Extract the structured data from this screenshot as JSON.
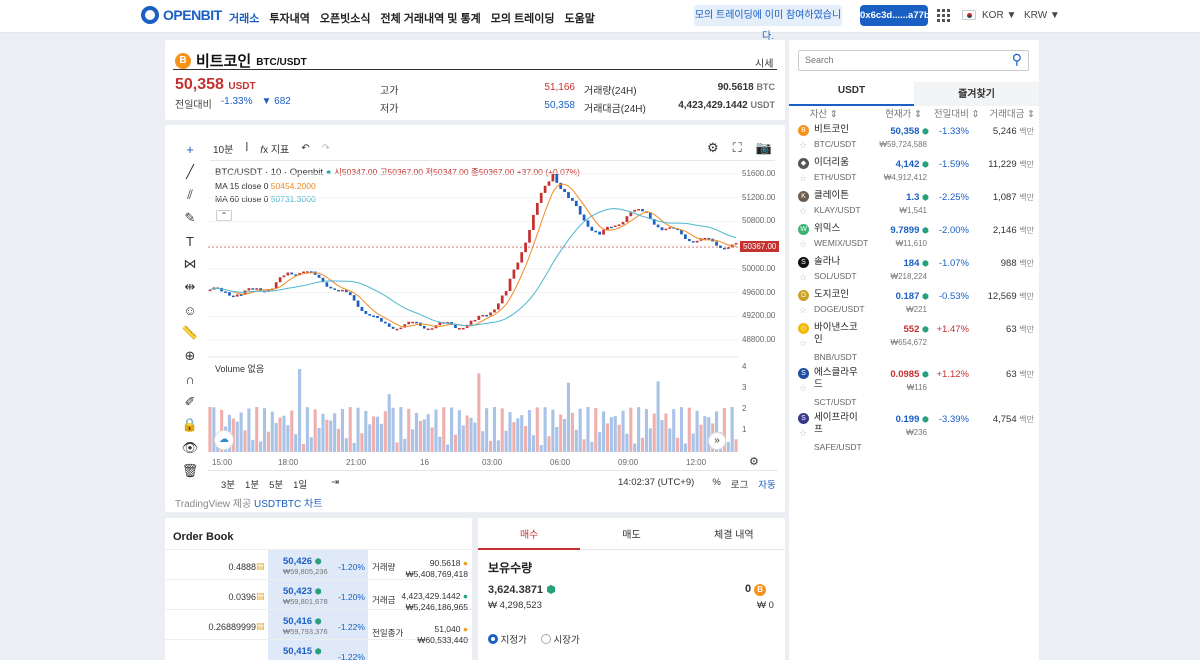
{
  "nav": {
    "logo": "OPENBIT",
    "menu": [
      "거래소",
      "투자내역",
      "오픈빗소식",
      "전체 거래내역 및 통계",
      "모의 트레이딩",
      "도움말"
    ],
    "notice": "모의 트레이딩에 이미 참여하였습니다.",
    "wallet": "0x6c3d......a77b",
    "lang": "KOR ▼",
    "currency": "KRW ▼"
  },
  "header": {
    "icon": "B",
    "name": "비트코인",
    "pair": "BTC/USDT",
    "tab": "시세",
    "price": "50,358",
    "unit": "USDT",
    "change_label": "전일대비",
    "change_pct": "-1.33%",
    "change_abs": "▼ 682",
    "stats": [
      {
        "label": "고가",
        "value": "51,166",
        "label2": "거래량(24H)",
        "value2": "90.5618",
        "unit2": "BTC"
      },
      {
        "label": "저가",
        "value": "50,358",
        "label2": "거래대금(24H)",
        "value2": "4,423,429.1442",
        "unit2": "USDT"
      }
    ]
  },
  "chart": {
    "interval": "10분",
    "indicators": "지표",
    "title": "BTC/USDT · 10 · Openbit",
    "ohlc": "시50347.00 고50367.00 저50347.00 종50367.00 +37.00 (+0.07%)",
    "ma15_label": "MA 15 close 0",
    "ma15": "50454.2000",
    "ma60_label": "MA 60 close 0",
    "ma60": "50731.3000",
    "last_price": "50367.00",
    "volume_label": "Volume",
    "volume_note": "없음",
    "yticks": [
      "51600.00",
      "51200.00",
      "50800.00",
      "50400.00",
      "50000.00",
      "49600.00",
      "49200.00",
      "48800.00"
    ],
    "vticks": [
      "4",
      "3",
      "2",
      "1"
    ],
    "xticks": [
      "15:00",
      "18:00",
      "21:00",
      "16",
      "03:00",
      "06:00",
      "09:00",
      "12:00"
    ],
    "ranges": [
      "3분",
      "1분",
      "5분",
      "1일"
    ],
    "time": "14:02:37 (UTC+9)",
    "pct": "%",
    "log": "로그",
    "auto": "자동",
    "footer_prefix": "TradingView 제공",
    "footer_link": "USDTBTC 차트"
  },
  "orderbook": {
    "title": "Order Book",
    "rows": [
      {
        "qty": "0.4888",
        "price": "50,426",
        "krw": "₩59,805,236",
        "pct": "-1.20%"
      },
      {
        "qty": "0.0396",
        "price": "50,423",
        "krw": "₩59,801,678",
        "pct": "-1.20%"
      },
      {
        "qty": "0.26889999",
        "price": "50,416",
        "krw": "₩59,793,376",
        "pct": "-1.22%"
      },
      {
        "qty": "",
        "price": "50,415",
        "krw": "",
        "pct": "-1.22%"
      }
    ],
    "info": [
      {
        "label": "거래량",
        "v1": "90.5618",
        "v2": "₩5,408,769,418"
      },
      {
        "label": "거래금",
        "v1": "4,423,429.1442",
        "v2": "₩5,246,186,965"
      },
      {
        "label": "전일종가",
        "v1": "51,040",
        "v2": "₩60,533,440"
      }
    ]
  },
  "trade": {
    "tabs": [
      "매수",
      "매도",
      "체결 내역"
    ],
    "holding_label": "보유수량",
    "usdt": "3,624.3871",
    "krw": "₩ 4,298,523",
    "btc": "0",
    "btc_krw": "₩ 0",
    "opt1": "지정가",
    "opt2": "시장가"
  },
  "sidebar": {
    "search_placeholder": "Search",
    "tabs": [
      "USDT",
      "즐겨찾기"
    ],
    "cols": [
      "자산",
      "현재가",
      "전일대비",
      "거래대금"
    ],
    "coins": [
      {
        "name": "비트코인",
        "pair": "BTC/USDT",
        "price": "50,358",
        "krw": "₩59,724,588",
        "pct": "-1.33%",
        "vol": "5,246",
        "dir": "down",
        "color": "#f7931a",
        "icon": "B"
      },
      {
        "name": "이더리움",
        "pair": "ETH/USDT",
        "price": "4,142",
        "krw": "₩4,912,412",
        "pct": "-1.59%",
        "vol": "11,229",
        "dir": "down",
        "color": "#555",
        "icon": "◆"
      },
      {
        "name": "클레이튼",
        "pair": "KLAY/USDT",
        "price": "1.3",
        "krw": "₩1,541",
        "pct": "-2.25%",
        "vol": "1,087",
        "dir": "down",
        "color": "#6b5d4f",
        "icon": "K"
      },
      {
        "name": "위믹스",
        "pair": "WEMIX/USDT",
        "price": "9.7899",
        "krw": "₩11,610",
        "pct": "-2.00%",
        "vol": "2,146",
        "dir": "down",
        "color": "#3cb371",
        "icon": "W"
      },
      {
        "name": "솔라나",
        "pair": "SOL/USDT",
        "price": "184",
        "krw": "₩218,224",
        "pct": "-1.07%",
        "vol": "988",
        "dir": "down",
        "color": "#111",
        "icon": "S"
      },
      {
        "name": "도지코인",
        "pair": "DOGE/USDT",
        "price": "0.187",
        "krw": "₩221",
        "pct": "-0.53%",
        "vol": "12,569",
        "dir": "down",
        "color": "#c9a227",
        "icon": "D"
      },
      {
        "name": "바이낸스코인",
        "pair": "BNB/USDT",
        "price": "552",
        "krw": "₩654,672",
        "pct": "+1.47%",
        "vol": "63",
        "dir": "up",
        "color": "#f0b90b",
        "icon": "◇"
      },
      {
        "name": "에스클라우드",
        "pair": "SCT/USDT",
        "price": "0.0985",
        "krw": "₩116",
        "pct": "+1.12%",
        "vol": "63",
        "dir": "up",
        "color": "#1e4fa0",
        "icon": "S"
      },
      {
        "name": "세이프라이프",
        "pair": "SAFE/USDT",
        "price": "0.199",
        "krw": "₩236",
        "pct": "-3.39%",
        "vol": "4,754",
        "dir": "down",
        "color": "#3a3a8a",
        "icon": "S"
      }
    ],
    "unit": "백만"
  }
}
